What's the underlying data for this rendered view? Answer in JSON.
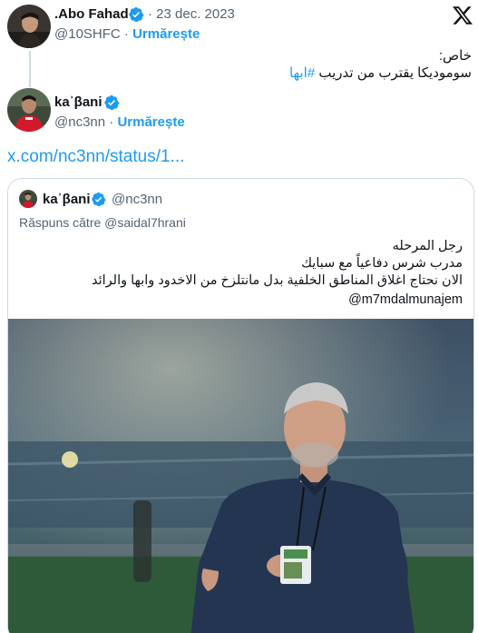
{
  "main_tweet": {
    "author_name": ".Abo Fahad",
    "handle_date": "@10SHFC · 23 dec. 2023",
    "date": "· 23 dec. 2023",
    "handle": "@10SHFC",
    "follow_label": "Urmărește",
    "text_line1": "خاص:",
    "text_line2_prefix": "سوموديكا يقترب من تدريب ",
    "hashtag": "#ابها"
  },
  "reply_tweet": {
    "author_name": "kaʾβani",
    "handle": "@nc3nn",
    "separator": "·",
    "follow_label": "Urmărește",
    "link": "x.com/nc3nn/status/1..."
  },
  "quoted_tweet": {
    "author_name": "kaʾβani",
    "handle": "@nc3nn",
    "reply_to": "Răspuns către @saidal7hrani",
    "lines": [
      "رجل المرحله",
      "مدرب شرس دفاعياً مع سبايك",
      "الان نحتاج اغلاق المناطق الخلفية بدل مانتلزخ من الاخدود وابها والرائد"
    ],
    "mention": "@m7mdalmunajem"
  },
  "colors": {
    "accent": "#1d9bf0",
    "text": "#0f1419",
    "muted": "#536471",
    "border": "#cfd9de"
  },
  "icons": [
    "x-logo-icon",
    "verified-badge-icon"
  ]
}
